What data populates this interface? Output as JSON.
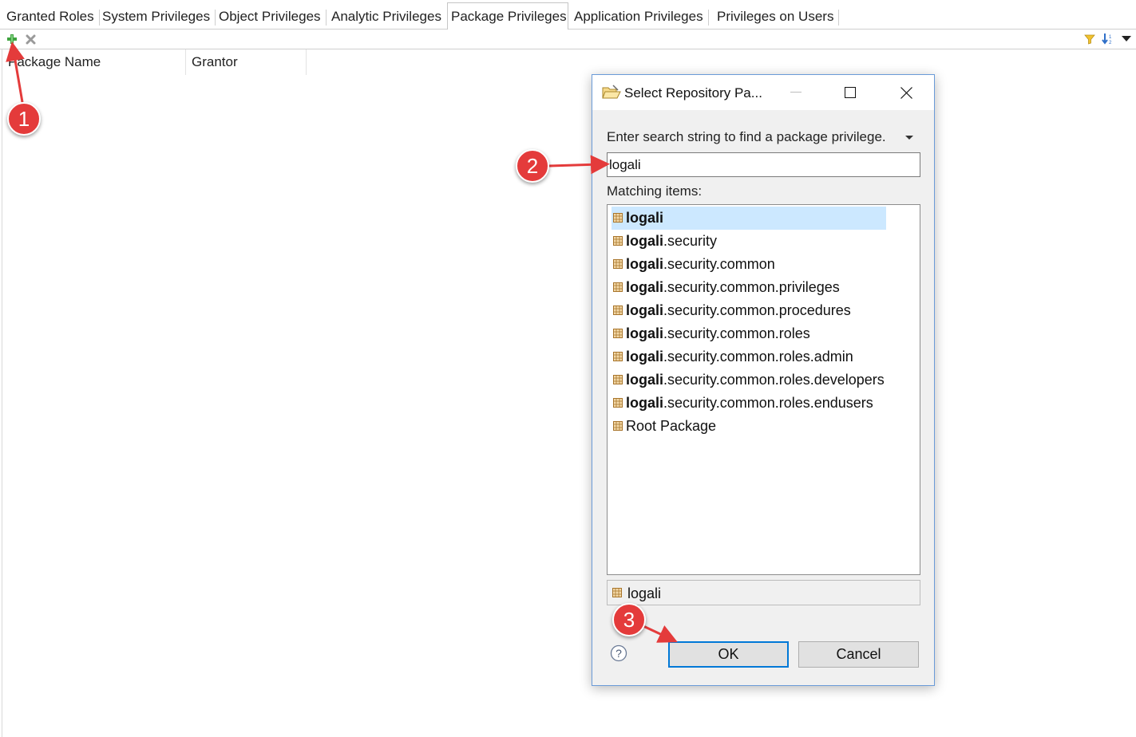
{
  "tabs": [
    {
      "label": "Granted Roles",
      "active": false
    },
    {
      "label": "System Privileges",
      "active": false
    },
    {
      "label": "Object Privileges",
      "active": false
    },
    {
      "label": "Analytic Privileges",
      "active": false
    },
    {
      "label": "Package Privileges",
      "active": true
    },
    {
      "label": "Application Privileges",
      "active": false
    },
    {
      "label": "Privileges on Users",
      "active": false
    }
  ],
  "toolbar": {
    "add_icon": "plus-icon",
    "remove_icon": "remove-icon",
    "filter_icon": "filter-icon",
    "sort_icon": "sort-icon",
    "menu_icon": "chevron-down-icon"
  },
  "table": {
    "columns": [
      "Package Name",
      "Grantor"
    ]
  },
  "dialog": {
    "title": "Select Repository Pa...",
    "search_label": "Enter search string to find a package privilege.",
    "search_value": "logali",
    "matching_label": "Matching items:",
    "items": [
      {
        "match": "logali",
        "rest": ""
      },
      {
        "match": "logali",
        "rest": ".security"
      },
      {
        "match": "logali",
        "rest": ".security.common"
      },
      {
        "match": "logali",
        "rest": ".security.common.privileges"
      },
      {
        "match": "logali",
        "rest": ".security.common.procedures"
      },
      {
        "match": "logali",
        "rest": ".security.common.roles"
      },
      {
        "match": "logali",
        "rest": ".security.common.roles.admin"
      },
      {
        "match": "logali",
        "rest": ".security.common.roles.developers"
      },
      {
        "match": "logali",
        "rest": ".security.common.roles.endusers"
      },
      {
        "match": "",
        "rest": "Root Package"
      }
    ],
    "selected_value": "logali",
    "ok_label": "OK",
    "cancel_label": "Cancel"
  },
  "callouts": [
    "1",
    "2",
    "3"
  ],
  "colors": {
    "callout": "#e43b3b",
    "selection": "#cce8ff",
    "dialog_border": "#6a9bd8",
    "ok_border": "#0078d7"
  }
}
